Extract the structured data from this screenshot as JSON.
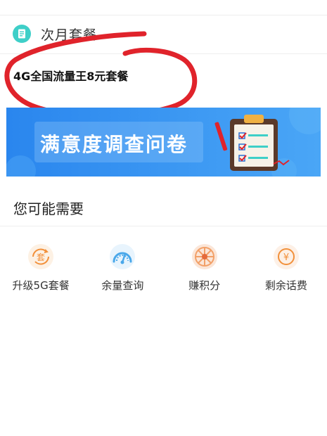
{
  "section": {
    "title": "次月套餐",
    "plan_name": "4G全国流量王8元套餐"
  },
  "banner": {
    "title": "满意度调查问卷"
  },
  "recommend": {
    "title": "您可能需要",
    "items": [
      {
        "label": "升级5G套餐",
        "icon": "package-upgrade-icon",
        "icon_text": "套"
      },
      {
        "label": "余量查询",
        "icon": "gauge-icon"
      },
      {
        "label": "赚积分",
        "icon": "points-wheel-icon"
      },
      {
        "label": "剩余话费",
        "icon": "balance-yuan-icon",
        "icon_text": "¥"
      }
    ]
  },
  "colors": {
    "header_icon": "#3ecfc8",
    "banner_bg": "#2f8ef0",
    "annotation": "#e0232b",
    "icon_orange": "#f2903a",
    "icon_blue": "#4aa8ea",
    "icon_peach": "#f2a068"
  }
}
